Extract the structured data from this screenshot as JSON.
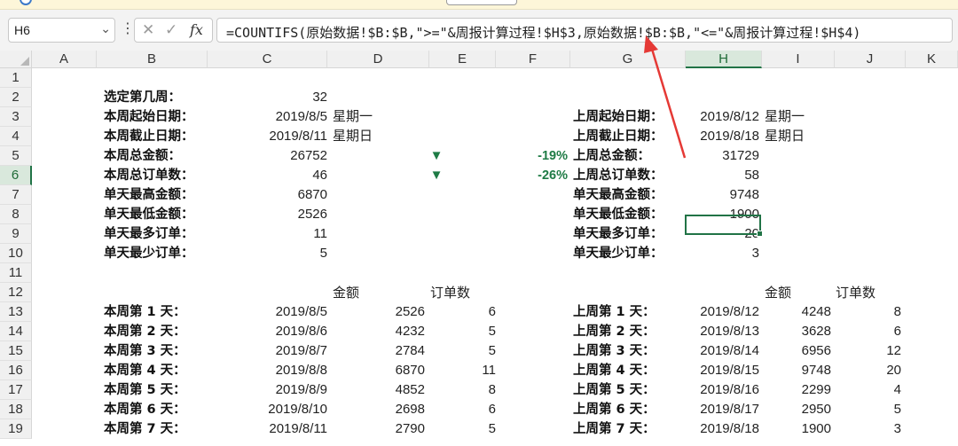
{
  "name_box": {
    "value": "H6"
  },
  "formula_bar": {
    "fx_label": "fx",
    "formula": "=COUNTIFS(原始数据!$B:$B,\">=\"&周报计算过程!$H$3,原始数据!$B:$B,\"<=\"&周报计算过程!$H$4)"
  },
  "columns": [
    "A",
    "B",
    "C",
    "D",
    "E",
    "F",
    "G",
    "H",
    "I",
    "J",
    "K"
  ],
  "rows": [
    "1",
    "2",
    "3",
    "4",
    "5",
    "6",
    "7",
    "8",
    "9",
    "10",
    "11",
    "12",
    "13",
    "14",
    "15",
    "16",
    "17",
    "18",
    "19"
  ],
  "selected": {
    "column": "H",
    "row": "6"
  },
  "current_week": {
    "week_label": "选定第几周：",
    "week_value": "32",
    "start_label": "本周起始日期：",
    "start_date": "2019/8/5",
    "start_weekday": "星期一",
    "end_label": "本周截止日期：",
    "end_date": "2019/8/11",
    "end_weekday": "星期日",
    "total_amount_label": "本周总金额：",
    "total_amount": "26752",
    "total_orders_label": "本周总订单数：",
    "total_orders": "46",
    "max_amount_label": "单天最高金额：",
    "max_amount": "6870",
    "min_amount_label": "单天最低金额：",
    "min_amount": "2526",
    "max_orders_label": "单天最多订单：",
    "max_orders": "11",
    "min_orders_label": "单天最少订单：",
    "min_orders": "5"
  },
  "change": {
    "amount_arrow": "▼",
    "amount_pct": "-19%",
    "orders_arrow": "▼",
    "orders_pct": "-26%"
  },
  "previous_week": {
    "start_label": "上周起始日期：",
    "start_date": "2019/8/12",
    "start_weekday": "星期一",
    "end_label": "上周截止日期：",
    "end_date": "2019/8/18",
    "end_weekday": "星期日",
    "total_amount_label": "上周总金额：",
    "total_amount": "31729",
    "total_orders_label": "上周总订单数：",
    "total_orders": "58",
    "max_amount_label": "单天最高金额：",
    "max_amount": "9748",
    "min_amount_label": "单天最低金额：",
    "min_amount": "1900",
    "max_orders_label": "单天最多订单：",
    "max_orders": "20",
    "min_orders_label": "单天最少订单：",
    "min_orders": "3"
  },
  "daily_headers": {
    "amount": "金额",
    "orders": "订单数"
  },
  "current_days": [
    {
      "label": "本周第 1 天：",
      "date": "2019/8/5",
      "amount": "2526",
      "orders": "6"
    },
    {
      "label": "本周第 2 天：",
      "date": "2019/8/6",
      "amount": "4232",
      "orders": "5"
    },
    {
      "label": "本周第 3 天：",
      "date": "2019/8/7",
      "amount": "2784",
      "orders": "5"
    },
    {
      "label": "本周第 4 天：",
      "date": "2019/8/8",
      "amount": "6870",
      "orders": "11"
    },
    {
      "label": "本周第 5 天：",
      "date": "2019/8/9",
      "amount": "4852",
      "orders": "8"
    },
    {
      "label": "本周第 6 天：",
      "date": "2019/8/10",
      "amount": "2698",
      "orders": "6"
    },
    {
      "label": "本周第 7 天：",
      "date": "2019/8/11",
      "amount": "2790",
      "orders": "5"
    }
  ],
  "previous_days": [
    {
      "label": "上周第 1 天：",
      "date": "2019/8/12",
      "amount": "4248",
      "orders": "8"
    },
    {
      "label": "上周第 2 天：",
      "date": "2019/8/13",
      "amount": "3628",
      "orders": "6"
    },
    {
      "label": "上周第 3 天：",
      "date": "2019/8/14",
      "amount": "6956",
      "orders": "12"
    },
    {
      "label": "上周第 4 天：",
      "date": "2019/8/15",
      "amount": "9748",
      "orders": "20"
    },
    {
      "label": "上周第 5 天：",
      "date": "2019/8/16",
      "amount": "2299",
      "orders": "4"
    },
    {
      "label": "上周第 6 天：",
      "date": "2019/8/17",
      "amount": "2950",
      "orders": "5"
    },
    {
      "label": "上周第 7 天：",
      "date": "2019/8/18",
      "amount": "1900",
      "orders": "3"
    }
  ],
  "colors": {
    "accent": "#217346",
    "down": "#1e7b45",
    "arrow": "#e53935"
  }
}
